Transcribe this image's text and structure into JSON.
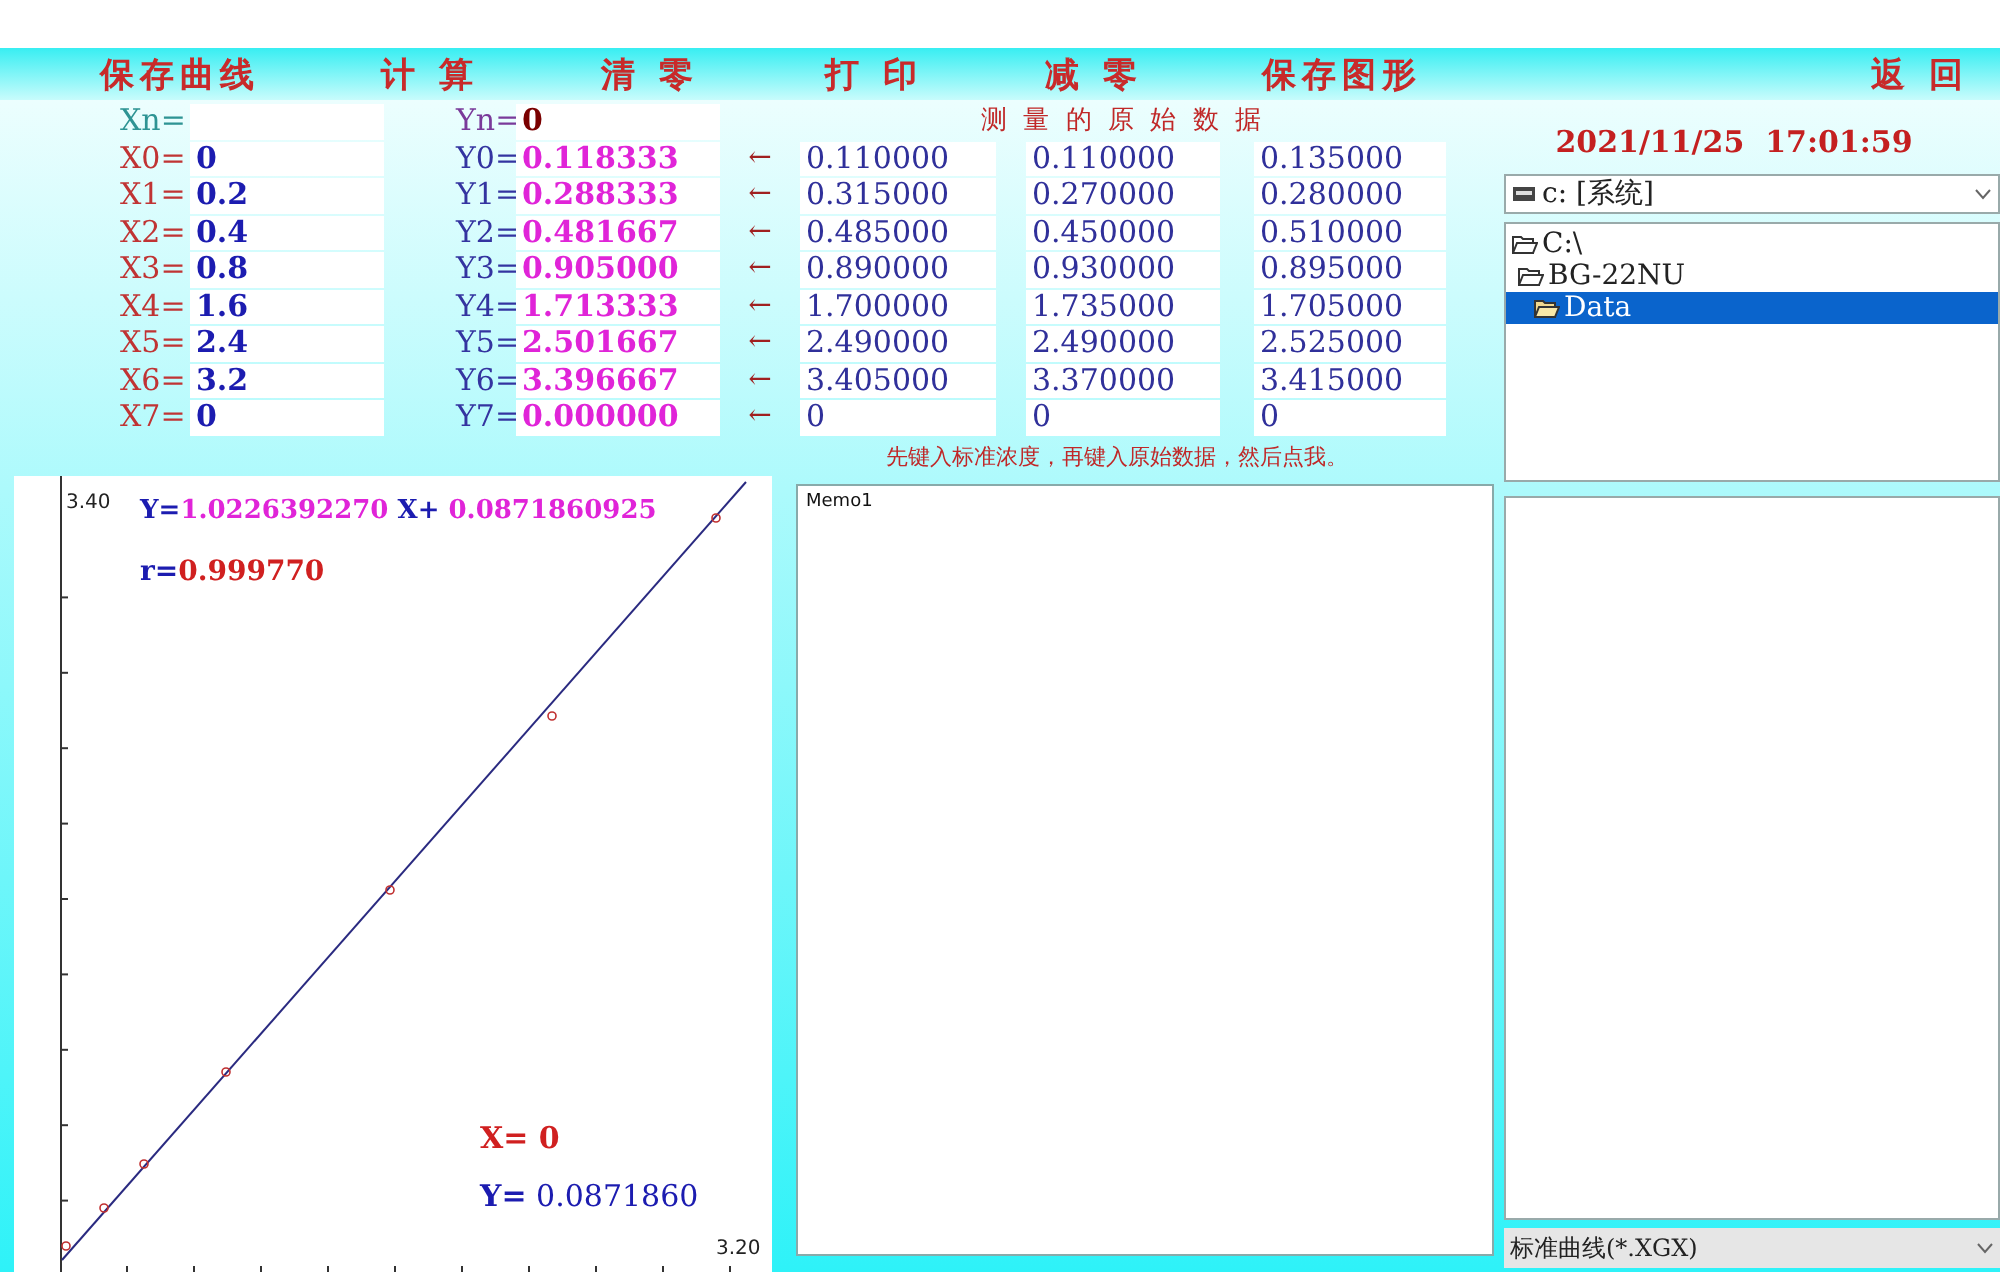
{
  "toolbar": [
    {
      "label": "保存曲线"
    },
    {
      "label": "计 算"
    },
    {
      "label": "清 零"
    },
    {
      "label": "打 印"
    },
    {
      "label": "减 零"
    },
    {
      "label": "保存图形"
    },
    {
      "label": "返 回"
    }
  ],
  "xn": {
    "label": "Xn="
  },
  "yn": {
    "label": "Yn=",
    "value": "0"
  },
  "raw_heading": "测 量 的 原 始 数 据",
  "rows": [
    {
      "x_label": "X0=",
      "x_value": "0",
      "y_label": "Y0=",
      "y_value": "0.118333",
      "arrow": "←",
      "raw": [
        "0.110000",
        "0.110000",
        "0.135000"
      ]
    },
    {
      "x_label": "X1=",
      "x_value": "0.2",
      "y_label": "Y1=",
      "y_value": "0.288333",
      "arrow": "←",
      "raw": [
        "0.315000",
        "0.270000",
        "0.280000"
      ]
    },
    {
      "x_label": "X2=",
      "x_value": "0.4",
      "y_label": "Y2=",
      "y_value": "0.481667",
      "arrow": "←",
      "raw": [
        "0.485000",
        "0.450000",
        "0.510000"
      ]
    },
    {
      "x_label": "X3=",
      "x_value": "0.8",
      "y_label": "Y3=",
      "y_value": "0.905000",
      "arrow": "←",
      "raw": [
        "0.890000",
        "0.930000",
        "0.895000"
      ]
    },
    {
      "x_label": "X4=",
      "x_value": "1.6",
      "y_label": "Y4=",
      "y_value": "1.713333",
      "arrow": "←",
      "raw": [
        "1.700000",
        "1.735000",
        "1.705000"
      ]
    },
    {
      "x_label": "X5=",
      "x_value": "2.4",
      "y_label": "Y5=",
      "y_value": "2.501667",
      "arrow": "←",
      "raw": [
        "2.490000",
        "2.490000",
        "2.525000"
      ]
    },
    {
      "x_label": "X6=",
      "x_value": "3.2",
      "y_label": "Y6=",
      "y_value": "3.396667",
      "arrow": "←",
      "raw": [
        "3.405000",
        "3.370000",
        "3.415000"
      ]
    },
    {
      "x_label": "X7=",
      "x_value": "0",
      "y_label": "Y7=",
      "y_value": "0.000000",
      "arrow": "←",
      "raw": [
        "0",
        "0",
        "0"
      ]
    }
  ],
  "hint": "先键入标准浓度，再键入原始数据，然后点我。",
  "chart": {
    "y_max_label": "3.40",
    "x_max_label": "3.20",
    "equation": {
      "y_part": "Y=",
      "slope": "1.0226392270",
      "x_part": "X+",
      "intercept": "0.0871860925"
    },
    "r": {
      "label": "r=",
      "value": "0.999770"
    },
    "x_readout": "X= 0",
    "y_readout": {
      "label": "Y=",
      "value": "0.0871860"
    }
  },
  "memo": {
    "text": "Memo1"
  },
  "datetime": "2021/11/25  17:01:59",
  "drive_combo": {
    "value": "c: [系统]"
  },
  "directories": [
    {
      "label": "C:\\",
      "selected": false,
      "children": [
        {
          "label": "BG-22NU",
          "selected": false,
          "children": [
            {
              "label": "Data",
              "selected": true
            }
          ]
        }
      ]
    }
  ],
  "filter_combo": {
    "value": "标准曲线(*.XGX)"
  }
}
